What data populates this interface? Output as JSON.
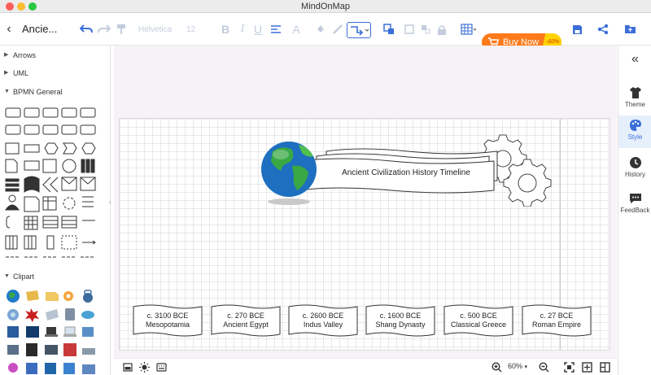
{
  "window": {
    "title": "MindOnMap"
  },
  "toolbar": {
    "doc_title": "Ancie...",
    "font_family": "Helvetica",
    "font_size": "12",
    "buy_now_label": "Buy Now",
    "discount_badge": "-60%",
    "accent_color": "#3b6fd8",
    "buy_color": "#ff7a1a"
  },
  "sidebar": {
    "sections": [
      {
        "label": "Arrows",
        "expanded": false
      },
      {
        "label": "UML",
        "expanded": false
      },
      {
        "label": "BPMN General",
        "expanded": true
      },
      {
        "label": "Clipart",
        "expanded": true
      }
    ]
  },
  "canvas": {
    "title_node": "Ancient Civilization History Timeline",
    "events": [
      {
        "date": "c. 3100 BCE",
        "name": "Mesopotamia"
      },
      {
        "date": "c. 270 BCE",
        "name": "Ancient Egypt"
      },
      {
        "date": "c. 2600 BCE",
        "name": "Indus Valley"
      },
      {
        "date": "c. 1600 BCE",
        "name": "Shang Dynasty"
      },
      {
        "date": "c. 500 BCE",
        "name": "Classical Greece"
      },
      {
        "date": "c. 27 BCE",
        "name": "Roman Empire"
      }
    ]
  },
  "bottom": {
    "zoom_label": "60%"
  },
  "rightpanel": {
    "collapse_icon": "double-chevron-left",
    "items": [
      {
        "label": "Theme",
        "icon": "tshirt-icon",
        "active": false
      },
      {
        "label": "Style",
        "icon": "palette-icon",
        "active": true
      },
      {
        "label": "History",
        "icon": "clock-icon",
        "active": false
      },
      {
        "label": "FeedBack",
        "icon": "chat-icon",
        "active": false
      }
    ]
  }
}
